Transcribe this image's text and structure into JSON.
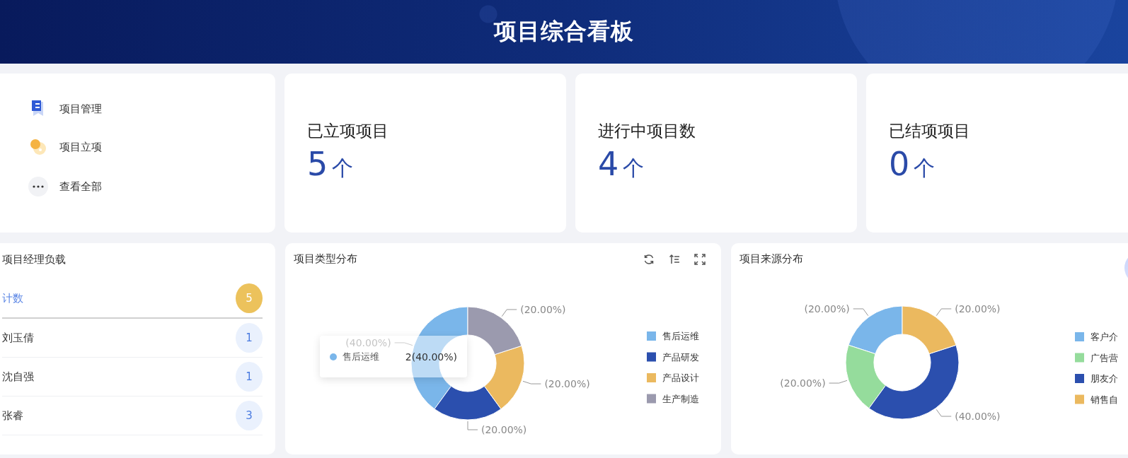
{
  "header": {
    "title": "项目综合看板"
  },
  "quick_links": [
    {
      "label": "项目管理",
      "kind": "document"
    },
    {
      "label": "项目立项",
      "kind": "coins"
    },
    {
      "label": "查看全部",
      "kind": "more"
    }
  ],
  "stats": [
    {
      "label": "已立项项目",
      "value": "5",
      "unit": "个"
    },
    {
      "label": "进行中项目数",
      "value": "4",
      "unit": "个"
    },
    {
      "label": "已结项项目",
      "value": "0",
      "unit": "个"
    }
  ],
  "manager_load": {
    "title": "项目经理负载",
    "rows": [
      {
        "name": "计数",
        "count": "5",
        "kind": "total"
      },
      {
        "name": "刘玉倩",
        "count": "1",
        "kind": "person"
      },
      {
        "name": "沈自强",
        "count": "1",
        "kind": "person"
      },
      {
        "name": "张睿",
        "count": "3",
        "kind": "person"
      }
    ]
  },
  "charts": [
    {
      "title": "项目类型分布",
      "kind": "tools",
      "legend": [
        {
          "color": "#7ab6ea"
        },
        {
          "color": "#2b4fae"
        },
        {
          "color": "#ebb95f"
        },
        {
          "color": "#9b9aae"
        }
      ],
      "chart_data": {
        "type": "donut",
        "categories": [
          "售后运维",
          "产品研发",
          "产品设计",
          "生产制造"
        ],
        "values": [
          40,
          20,
          20,
          20
        ],
        "value_labels": [
          "(40.00%)",
          "(20.00%)",
          "(20.00%)",
          "(20.00%)"
        ],
        "legend": "right"
      },
      "tooltip": {
        "name": "售后运维",
        "value": "2(40.00%)",
        "color": "#7ab6ea"
      }
    },
    {
      "title": "项目来源分布",
      "kind": "round",
      "legend": [
        {
          "color": "#7ab6ea"
        },
        {
          "color": "#95dc9c"
        },
        {
          "color": "#2b4fae"
        },
        {
          "color": "#ebb95f"
        }
      ],
      "chart_data": {
        "type": "donut",
        "categories": [
          "客户介",
          "广告营",
          "朋友介",
          "销售自"
        ],
        "values": [
          20,
          20,
          40,
          20
        ],
        "value_labels": [
          "(20.00%)",
          "(20.00%)",
          "(40.00%)",
          "(20.00%)"
        ],
        "legend": "right"
      }
    }
  ]
}
